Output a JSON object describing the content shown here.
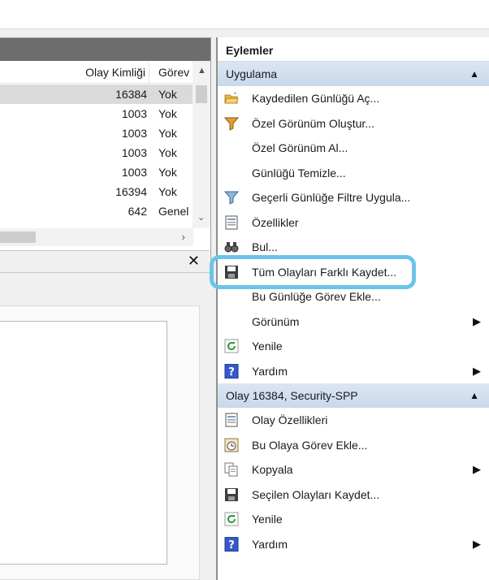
{
  "events_grid": {
    "columns": [
      "Olay Kimliği",
      "Görev"
    ],
    "rows": [
      {
        "id": "16384",
        "task": "Yok"
      },
      {
        "id": "1003",
        "task": "Yok"
      },
      {
        "id": "1003",
        "task": "Yok"
      },
      {
        "id": "1003",
        "task": "Yok"
      },
      {
        "id": "1003",
        "task": "Yok"
      },
      {
        "id": "16394",
        "task": "Yok"
      },
      {
        "id": "642",
        "task": "Genel"
      }
    ]
  },
  "actions": {
    "title": "Eylemler",
    "sections": [
      {
        "title": "Uygulama",
        "items": [
          {
            "label": "Kaydedilen Günlüğü Aç...",
            "icon": "folder-open-icon"
          },
          {
            "label": "Özel Görünüm Oluştur...",
            "icon": "filter-icon"
          },
          {
            "label": "Özel Görünüm Al...",
            "icon": ""
          },
          {
            "label": "Günlüğü Temizle...",
            "icon": ""
          },
          {
            "label": "Geçerli Günlüğe Filtre Uygula...",
            "icon": "filter-icon"
          },
          {
            "label": "Özellikler",
            "icon": "properties-icon"
          },
          {
            "label": "Bul...",
            "icon": "binoculars-icon"
          },
          {
            "label": "Tüm Olayları Farklı Kaydet...",
            "icon": "save-icon"
          },
          {
            "label": "Bu Günlüğe Görev Ekle...",
            "icon": ""
          },
          {
            "label": "Görünüm",
            "icon": "",
            "submenu": "▶"
          },
          {
            "label": "Yenile",
            "icon": "refresh-icon"
          },
          {
            "label": "Yardım",
            "icon": "help-icon",
            "submenu": "▶"
          }
        ]
      },
      {
        "title": "Olay 16384, Security-SPP",
        "items": [
          {
            "label": "Olay Özellikleri",
            "icon": "properties-icon"
          },
          {
            "label": "Bu Olaya Görev Ekle...",
            "icon": "task-clock-icon"
          },
          {
            "label": "Kopyala",
            "icon": "copy-icon",
            "submenu": "▶"
          },
          {
            "label": "Seçilen Olayları Kaydet...",
            "icon": "save-icon"
          },
          {
            "label": "Yenile",
            "icon": "refresh-icon"
          },
          {
            "label": "Yardım",
            "icon": "help-icon",
            "submenu": "▶"
          }
        ]
      }
    ]
  },
  "colors": {
    "section_header": "#c9d8ec",
    "highlight": "#6cc4ea",
    "selected_row": "#dadada"
  }
}
